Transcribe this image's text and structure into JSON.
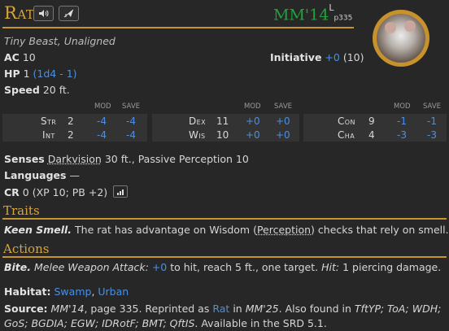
{
  "header": {
    "name_first": "R",
    "name_rest": "AT",
    "source_abbr": "MM'14",
    "source_sup": "L",
    "source_page": "p335"
  },
  "meta": {
    "type_line": "Tiny Beast, Unaligned",
    "ac_label": "AC",
    "ac_value": "10",
    "initiative_label": "Initiative",
    "initiative_mod": "+0",
    "initiative_score": "(10)",
    "hp_label": "HP",
    "hp_value": "1",
    "hp_dice": "(1d4 - 1)",
    "speed_label": "Speed",
    "speed_value": "20 ft."
  },
  "abilities": {
    "mod_label": "MOD",
    "save_label": "SAVE",
    "str": {
      "name": "Str",
      "score": "2",
      "mod": "-4",
      "save": "-4"
    },
    "int": {
      "name": "Int",
      "score": "2",
      "mod": "-4",
      "save": "-4"
    },
    "dex": {
      "name": "Dex",
      "score": "11",
      "mod": "+0",
      "save": "+0"
    },
    "wis": {
      "name": "Wis",
      "score": "10",
      "mod": "+0",
      "save": "+0"
    },
    "con": {
      "name": "Con",
      "score": "9",
      "mod": "-1",
      "save": "-1"
    },
    "cha": {
      "name": "Cha",
      "score": "4",
      "mod": "-3",
      "save": "-3"
    }
  },
  "details": {
    "senses_label": "Senses",
    "senses_darkvision": "Darkvision",
    "senses_rest": "30 ft., Passive Perception 10",
    "languages_label": "Languages",
    "languages_value": "—",
    "cr_label": "CR",
    "cr_value": "0 (XP 10; PB +2)"
  },
  "traits": {
    "heading": "Traits",
    "name": "Keen Smell.",
    "text_a": "The rat has advantage on Wisdom (",
    "link": "Perception",
    "text_b": ") checks that rely on smell."
  },
  "actions": {
    "heading": "Actions",
    "name": "Bite.",
    "attack_type": "Melee Weapon Attack:",
    "to_hit": "+0",
    "text_a": "to hit, reach 5 ft., one target.",
    "hit_label": "Hit:",
    "hit_text": "1 piercing damage."
  },
  "footer": {
    "habitat_label": "Habitat:",
    "habitat_a": "Swamp",
    "habitat_b": "Urban",
    "source_label": "Source:",
    "source_book": "MM'14",
    "source_page": ", page 335. Reprinted as",
    "reprint_link": "Rat",
    "reprint_in": "in",
    "reprint_book": "MM'25",
    "also_found": ". Also found in",
    "books": "TftYP; ToA; WDH;",
    "books2": "GoS; BGDIA; EGW; IDRotF; BMT; QftIS",
    "srd": ". Available in the SRD 5.1."
  },
  "icons": {
    "speak": "speaker-icon",
    "send": "send-to-chat-icon",
    "cr_chart": "bar-chart-icon",
    "token": "rat-token-portrait"
  },
  "colors": {
    "accent_gold": "#d9a53c",
    "source_green": "#1fa43a",
    "link_blue": "#4c8fe0",
    "background": "#272727"
  }
}
